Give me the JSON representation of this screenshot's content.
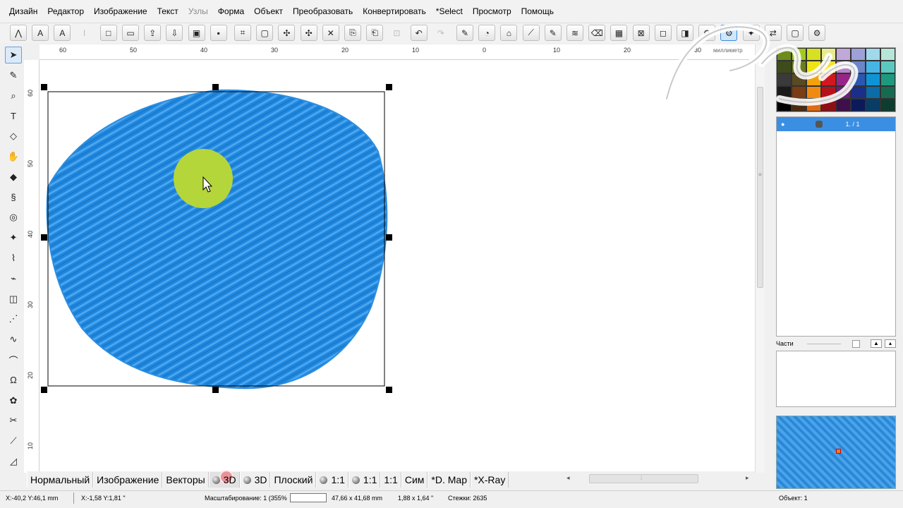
{
  "menu": [
    "Дизайн",
    "Редактор",
    "Изображение",
    "Текст",
    "Узлы",
    "Форма",
    "Объект",
    "Преобразовать",
    "Конвертировать",
    "*Select",
    "Просмотр",
    "Помощь"
  ],
  "menu_disabled": [
    "Узлы"
  ],
  "toolbar_icons": [
    "stitch-run-icon",
    "text-a-icon",
    "text-outline-icon",
    "text-vertical-icon",
    "new-document-icon",
    "open-folder-icon",
    "import-icon",
    "export-icon",
    "save-as-icon",
    "save-icon",
    "select-all-icon",
    "rectangle-select-icon",
    "sparkle-select-icon",
    "sparkle-select-2-icon",
    "delete-icon",
    "copy-icon",
    "paste-icon",
    "lock-icon",
    "undo-icon",
    "redo-icon",
    "node-edit-icon",
    "measure-icon",
    "shape-icon",
    "eyedropper-icon",
    "edit-icon",
    "layers-icon",
    "eraser-icon",
    "grid-icon",
    "zoom-fit-icon",
    "frame-icon",
    "selection-icon",
    "gear-icon",
    "gear-2-icon",
    "star-icon",
    "export-2-icon",
    "window-icon",
    "settings-icon"
  ],
  "left_tools": [
    "pointer-icon",
    "node-tool-icon",
    "zoom-icon",
    "text-tool-icon",
    "lasso-icon",
    "hand-icon",
    "fill-icon",
    "satin-icon",
    "circle-tool-icon",
    "applique-icon",
    "freehand-icon",
    "tatami-icon",
    "column-icon",
    "zigzag-icon",
    "run-stitch-icon",
    "bezier-icon",
    "monogram-icon",
    "ornament-icon",
    "scissors-icon",
    "knife-icon",
    "ruler-icon"
  ],
  "hruler_ticks": [
    "60",
    "50",
    "40",
    "30",
    "20",
    "10",
    "0",
    "10",
    "20",
    "30"
  ],
  "hruler_unit": "миллиметр",
  "vruler_ticks": [
    "60",
    "50",
    "40",
    "30",
    "20",
    "10"
  ],
  "layers": {
    "row_label": "1. / 1"
  },
  "parts": {
    "label": "Части"
  },
  "view_tabs": [
    {
      "label": "Нормальный",
      "icon": false
    },
    {
      "label": "Изображение",
      "icon": false
    },
    {
      "label": "Векторы",
      "icon": false
    },
    {
      "label": "3D",
      "icon": true,
      "pressed": true
    },
    {
      "label": "3D",
      "icon": true
    },
    {
      "label": "Плоский",
      "icon": false
    },
    {
      "label": "1:1",
      "icon": true
    },
    {
      "label": "1:1",
      "icon": true
    },
    {
      "label": "1:1",
      "icon": false
    },
    {
      "label": "Сим",
      "icon": false
    },
    {
      "label": "*D. Map",
      "icon": false
    },
    {
      "label": "*X-Ray",
      "icon": false
    }
  ],
  "status": {
    "cursor_abs": "X:-40,2   Y:46,1 mm",
    "cursor_rel": "X:-1,58   Y:1,81 \"",
    "scale": "Масштабирование: 1 (355%",
    "size_mm": "47,66 x 41,68 mm",
    "size_in": "1,88 x 1,64 \"",
    "stitches": "Стежки: 2635",
    "object": "Объект: 1"
  },
  "colors": {
    "fill_blue": "#1f86dd",
    "fill_blue_light": "#4aa6f0",
    "spot_green": "#b5d63a",
    "layer_selected": "#3b8fe2"
  },
  "palette": [
    "#6f8a1d",
    "#a3c81f",
    "#d7e021",
    "#e7eb8f",
    "#c0a8d8",
    "#9ea0d8",
    "#9fd9ea",
    "#b6e6d8",
    "#3d4c1a",
    "#6b7d1d",
    "#efe313",
    "#f5e12d",
    "#b685c6",
    "#6a86c9",
    "#45b5e6",
    "#5bc8c0",
    "#3a3a3a",
    "#5a4a22",
    "#f2a20d",
    "#d2181f",
    "#98248a",
    "#2a57b0",
    "#0e94d6",
    "#1d9a7d",
    "#1a1a1a",
    "#7a3d14",
    "#f18a10",
    "#b5131b",
    "#6b1f7a",
    "#1a2f8a",
    "#0c6ca8",
    "#176a52",
    "#000000",
    "#4b2a10",
    "#e06a12",
    "#8c0f15",
    "#3e0f4a",
    "#0b1a5a",
    "#083d66",
    "#0d3d2e"
  ]
}
